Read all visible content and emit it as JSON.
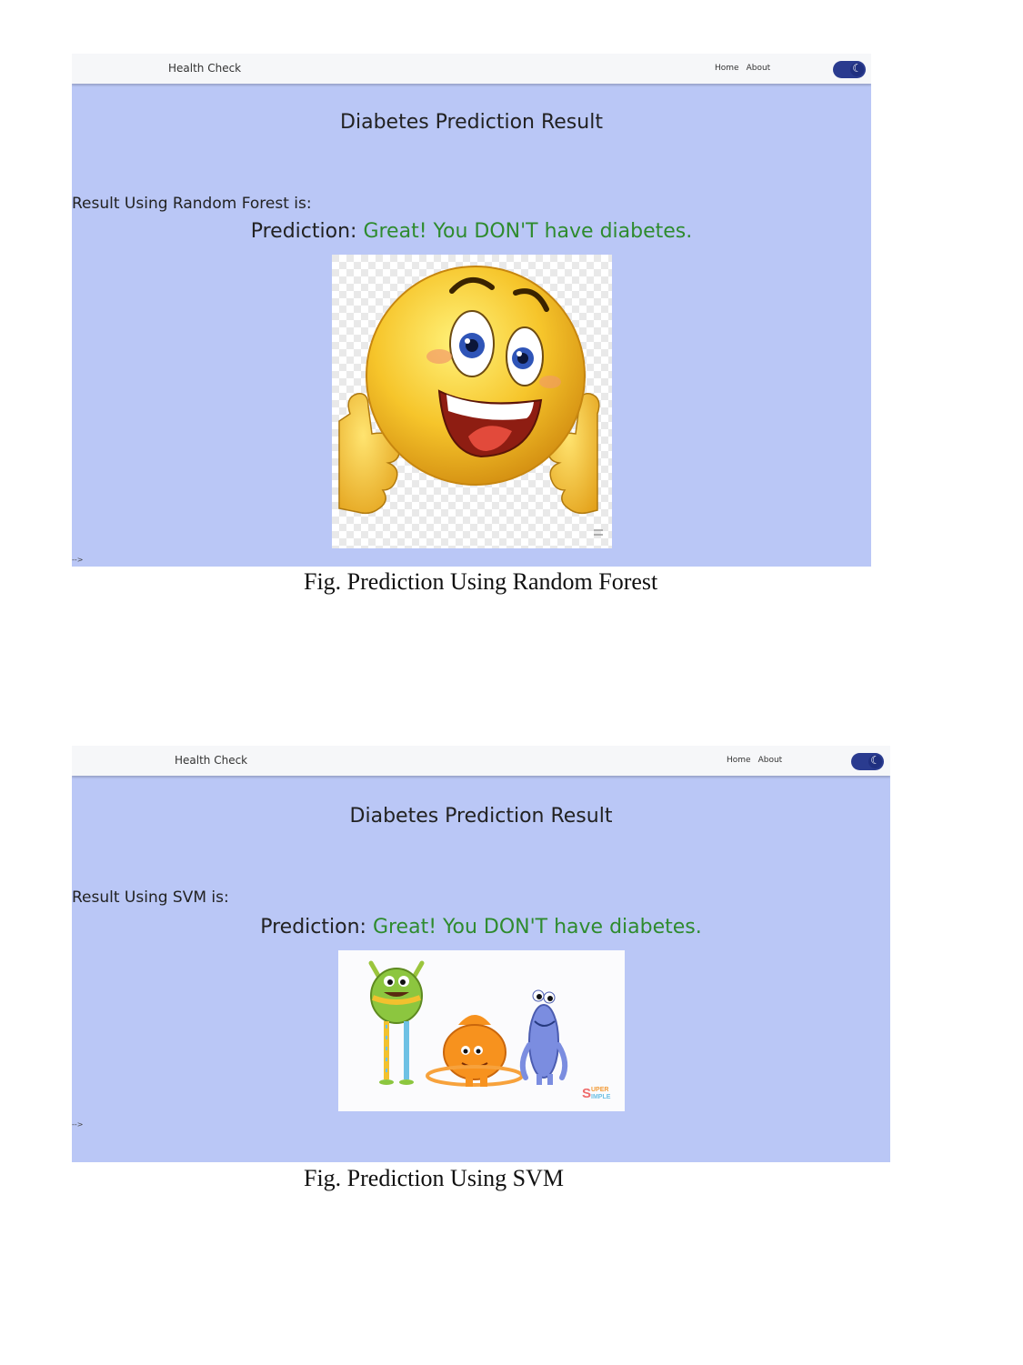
{
  "figures": [
    {
      "navbar": {
        "brand": "Health Check",
        "links": [
          "Home",
          "About"
        ],
        "toggle_icon": "moon-icon"
      },
      "title": "Diabetes Prediction Result",
      "result_label": "Result Using Random Forest is:",
      "prediction_label": "Prediction:",
      "prediction_value": "Great! You DON'T have diabetes.",
      "comment_marker": "-->",
      "image": "thumbs-up-smiley-emoji",
      "caption": "Fig. Prediction Using Random Forest"
    },
    {
      "navbar": {
        "brand": "Health Check",
        "links": [
          "Home",
          "About"
        ],
        "toggle_icon": "moon-icon"
      },
      "title": "Diabetes Prediction Result",
      "result_label": "Result Using SVM is:",
      "prediction_label": "Prediction:",
      "prediction_value": "Great! You DON'T have diabetes.",
      "comment_marker": "-->",
      "image": "cartoon-monsters",
      "image_watermark": "SUPER SIMPLE",
      "caption": "Fig. Prediction Using SVM"
    }
  ],
  "colors": {
    "page_bg": "#bac7f6",
    "verdict": "#2e8b2e",
    "toggle": "#2a3b8f"
  }
}
